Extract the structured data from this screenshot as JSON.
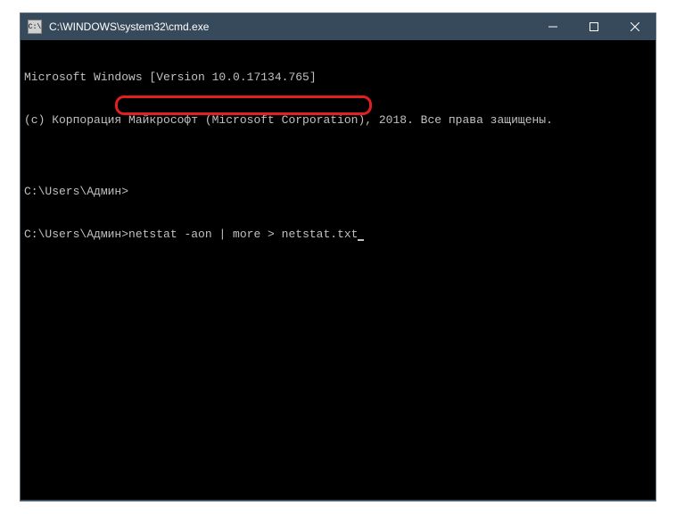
{
  "window": {
    "title": "C:\\WINDOWS\\system32\\cmd.exe"
  },
  "terminal": {
    "line1": "Microsoft Windows [Version 10.0.17134.765]",
    "line2": "(с) Корпорация Майкрософт (Microsoft Corporation), 2018. Все права защищены.",
    "line3": "",
    "prompt1": "C:\\Users\\Админ>",
    "prompt2_prefix": "C:\\Users\\Админ>",
    "command": "netstat -aon | more > netstat.txt"
  }
}
